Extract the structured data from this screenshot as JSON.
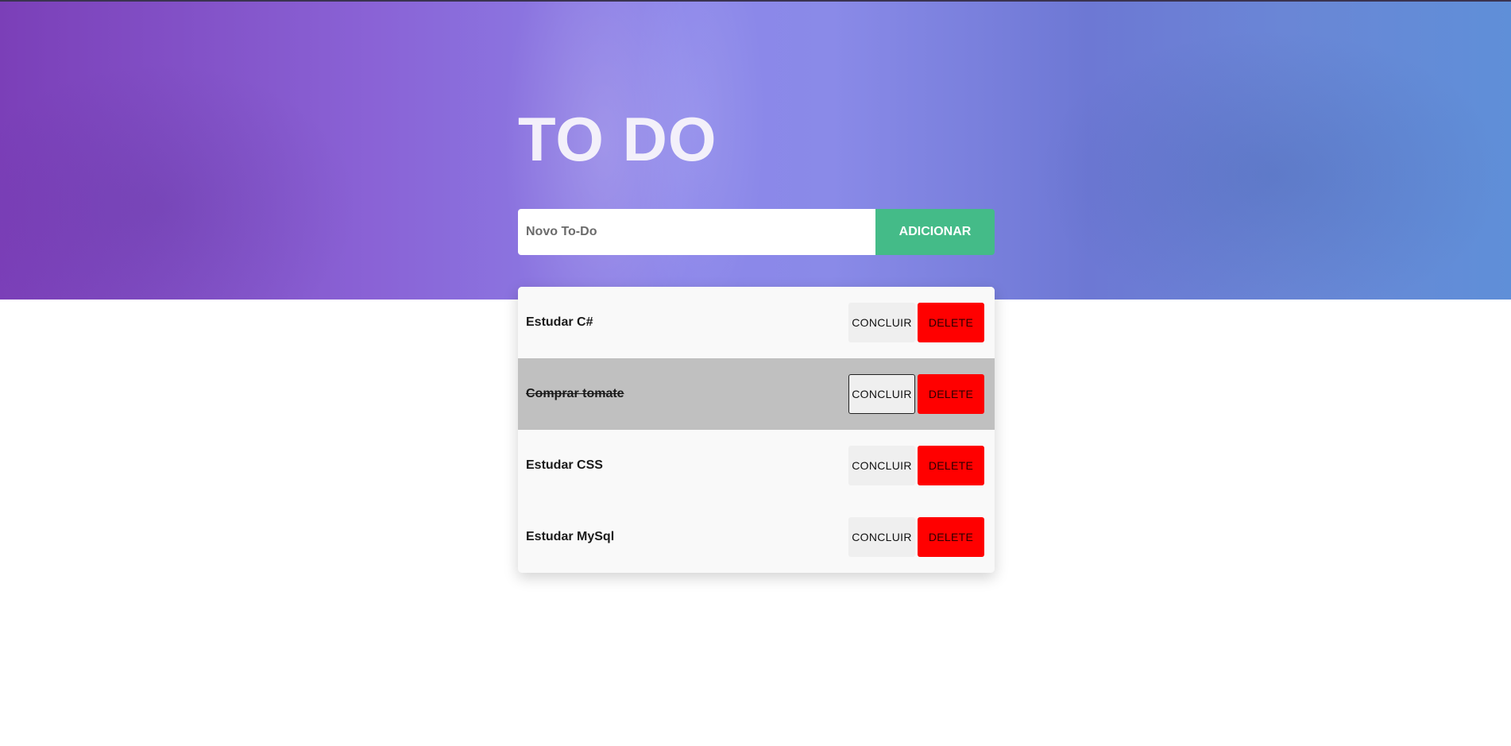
{
  "header": {
    "title": "TO DO"
  },
  "form": {
    "placeholder": "Novo To-Do",
    "value": "",
    "add_label": "ADICIONAR"
  },
  "todos": [
    {
      "label": "Estudar C#",
      "done": false,
      "conclude_label": "CONCLUIR",
      "delete_label": "DELETE"
    },
    {
      "label": "Comprar tomate",
      "done": true,
      "conclude_label": "CONCLUIR",
      "delete_label": "DELETE"
    },
    {
      "label": "Estudar CSS",
      "done": false,
      "conclude_label": "CONCLUIR",
      "delete_label": "DELETE"
    },
    {
      "label": "Estudar MySql",
      "done": false,
      "conclude_label": "CONCLUIR",
      "delete_label": "DELETE"
    }
  ],
  "colors": {
    "accent_green": "#44bb88",
    "delete_red": "#ff0000",
    "done_row": "#c0c0c0"
  }
}
